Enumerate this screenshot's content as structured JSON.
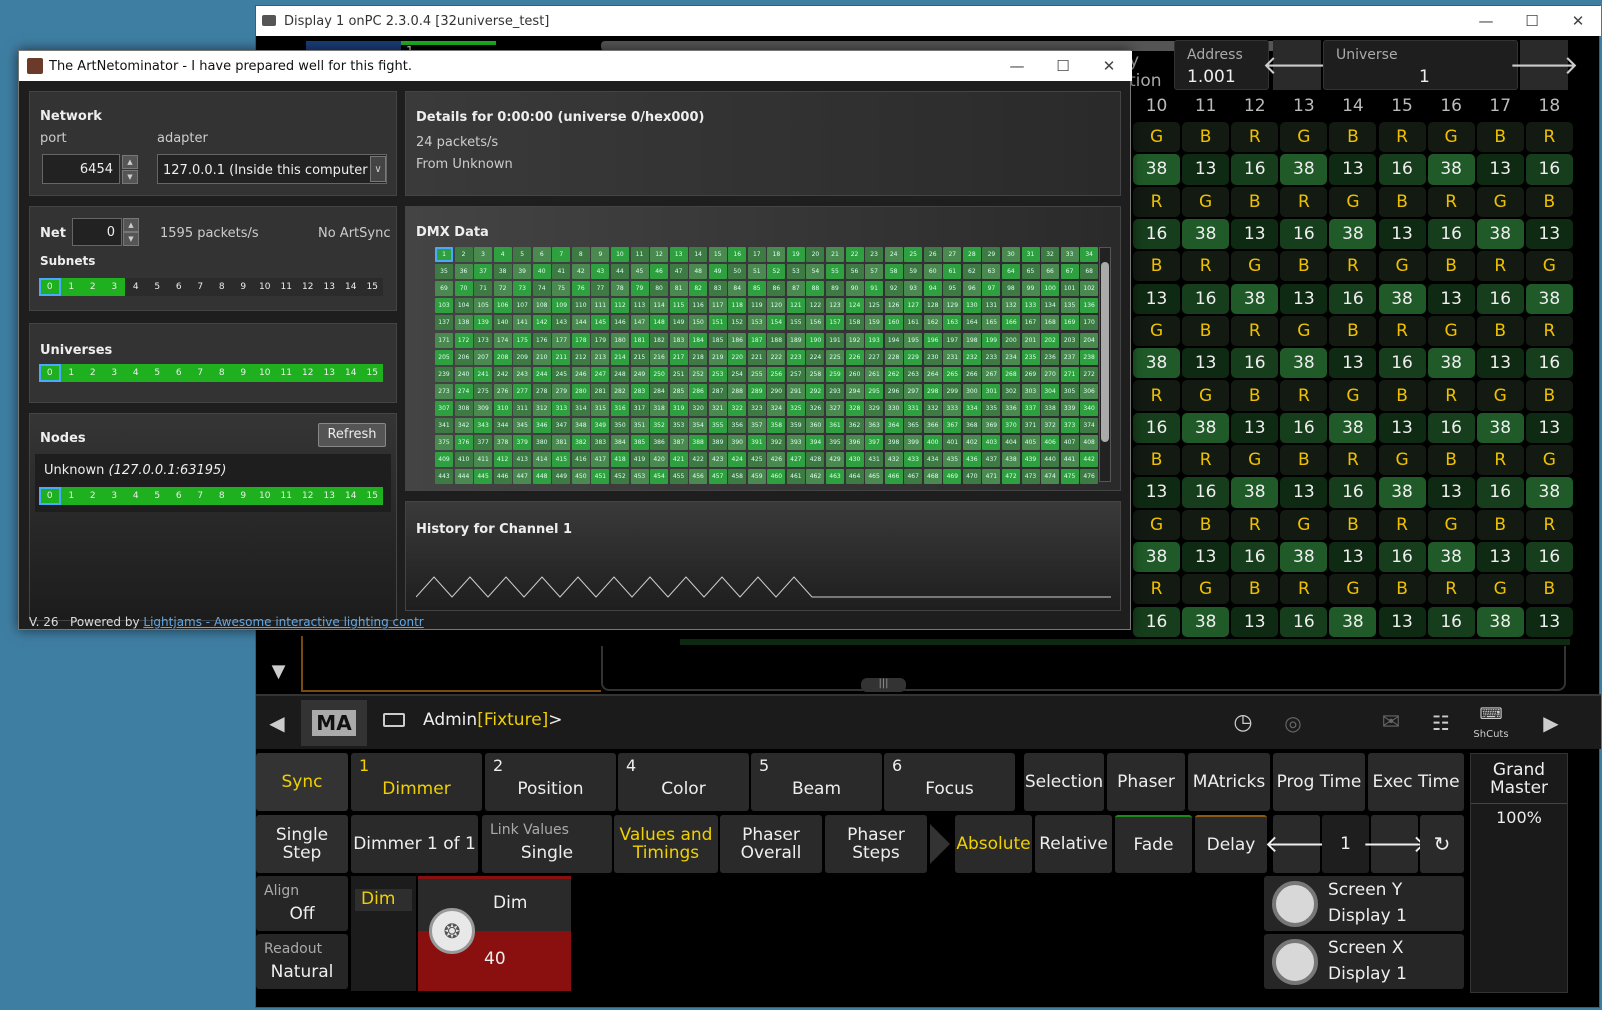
{
  "ma_window": {
    "title": "Display 1 onPC 2.3.0.4 [32universe_test]",
    "address_label": "Address",
    "address_value": "1.001",
    "universe_label": "Universe",
    "universe_value": "1",
    "partial_label_top": "y",
    "partial_label_bottom": "tion",
    "grid": {
      "columns": [
        "10",
        "11",
        "12",
        "13",
        "14",
        "15",
        "16",
        "17",
        "18"
      ],
      "rows": [
        [
          "G",
          "B",
          "R",
          "G",
          "B",
          "R",
          "G",
          "B",
          "R"
        ],
        [
          "38",
          "13",
          "16",
          "38",
          "13",
          "16",
          "38",
          "13",
          "16"
        ],
        [
          "R",
          "G",
          "B",
          "R",
          "G",
          "B",
          "R",
          "G",
          "B"
        ],
        [
          "16",
          "38",
          "13",
          "16",
          "38",
          "13",
          "16",
          "38",
          "13"
        ],
        [
          "B",
          "R",
          "G",
          "B",
          "R",
          "G",
          "B",
          "R",
          "G"
        ],
        [
          "13",
          "16",
          "38",
          "13",
          "16",
          "38",
          "13",
          "16",
          "38"
        ],
        [
          "G",
          "B",
          "R",
          "G",
          "B",
          "R",
          "G",
          "B",
          "R"
        ],
        [
          "38",
          "13",
          "16",
          "38",
          "13",
          "16",
          "38",
          "13",
          "16"
        ],
        [
          "R",
          "G",
          "B",
          "R",
          "G",
          "B",
          "R",
          "G",
          "B"
        ],
        [
          "16",
          "38",
          "13",
          "16",
          "38",
          "13",
          "16",
          "38",
          "13"
        ],
        [
          "B",
          "R",
          "G",
          "B",
          "R",
          "G",
          "B",
          "R",
          "G"
        ],
        [
          "13",
          "16",
          "38",
          "13",
          "16",
          "38",
          "13",
          "16",
          "38"
        ],
        [
          "G",
          "B",
          "R",
          "G",
          "B",
          "R",
          "G",
          "B",
          "R"
        ],
        [
          "38",
          "13",
          "16",
          "38",
          "13",
          "16",
          "38",
          "13",
          "16"
        ],
        [
          "R",
          "G",
          "B",
          "R",
          "G",
          "B",
          "R",
          "G",
          "B"
        ],
        [
          "16",
          "38",
          "13",
          "16",
          "38",
          "13",
          "16",
          "38",
          "13"
        ]
      ]
    },
    "command_line": {
      "prefix": "Admin",
      "bracket": "[Fixture]",
      "suffix": ">",
      "ma_logo": "MA",
      "shortcuts_label": "ShCuts"
    },
    "preset_bar": {
      "sync": "Sync",
      "presets": [
        {
          "num": "1",
          "label": "Dimmer"
        },
        {
          "num": "2",
          "label": "Position"
        },
        {
          "num": "4",
          "label": "Color"
        },
        {
          "num": "5",
          "label": "Beam"
        },
        {
          "num": "6",
          "label": "Focus"
        }
      ],
      "selection": "Selection",
      "phaser": "Phaser",
      "matricks": "MAtricks",
      "prog_time": "Prog Time",
      "exec_time": "Exec Time",
      "grand_master": "Grand Master",
      "grand_master_value": "100%"
    },
    "row2": {
      "single_step": "Single Step",
      "dimmer_of": "Dimmer 1 of 1",
      "link_values_label": "Link Values",
      "link_values_value": "Single",
      "values_timings": "Values and Timings",
      "phaser_overall": "Phaser Overall",
      "phaser_steps": "Phaser Steps",
      "absolute": "Absolute",
      "relative": "Relative",
      "fade": "Fade",
      "delay": "Delay",
      "page_value": "1"
    },
    "row3": {
      "align_label": "Align",
      "align_value": "Off",
      "readout_label": "Readout",
      "readout_value": "Natural",
      "dim_tab": "Dim",
      "encoder_label": "Dim",
      "encoder_value": "40",
      "screen_y_label": "Screen Y",
      "screen_y_value": "Display 1",
      "screen_x_label": "Screen X",
      "screen_x_value": "Display 1"
    },
    "top_strip_value": "1"
  },
  "artnet_window": {
    "title": "The ArtNetominator - I have prepared well for this fight.",
    "network": {
      "title": "Network",
      "port_label": "port",
      "adapter_label": "adapter",
      "port_value": "6454",
      "adapter_value": "127.0.0.1 (Inside this computer only)"
    },
    "net": {
      "label": "Net",
      "value": "0",
      "packets": "1595 packets/s",
      "artsync": "No ArtSync",
      "subnets_label": "Subnets",
      "subnets": [
        "0",
        "1",
        "2",
        "3",
        "4",
        "5",
        "6",
        "7",
        "8",
        "9",
        "10",
        "11",
        "12",
        "13",
        "14",
        "15"
      ],
      "subnets_active": 4
    },
    "universes": {
      "title": "Universes",
      "items": [
        "0",
        "1",
        "2",
        "3",
        "4",
        "5",
        "6",
        "7",
        "8",
        "9",
        "10",
        "11",
        "12",
        "13",
        "14",
        "15"
      ]
    },
    "nodes": {
      "title": "Nodes",
      "refresh": "Refresh",
      "node_name": "Unknown",
      "node_addr": "(127.0.0.1:63195)",
      "items": [
        "0",
        "1",
        "2",
        "3",
        "4",
        "5",
        "6",
        "7",
        "8",
        "9",
        "10",
        "11",
        "12",
        "13",
        "14",
        "15"
      ]
    },
    "details": {
      "title": "Details for 0:00:00 (universe 0/hex000)",
      "packets": "24 packets/s",
      "from": "From Unknown"
    },
    "dmx": {
      "title": "DMX Data",
      "first_channel": 1,
      "last_channel": 476,
      "per_row": 34
    },
    "history": {
      "title": "History for Channel 1"
    },
    "footer": {
      "version": "V. 26",
      "powered": "Powered by",
      "link": "Lightjams - Awesome interactive lighting contr"
    }
  },
  "colors": {
    "active_green": "#1fb01f",
    "ma_yellow": "#f0d000",
    "dim_red": "#8a1010"
  }
}
